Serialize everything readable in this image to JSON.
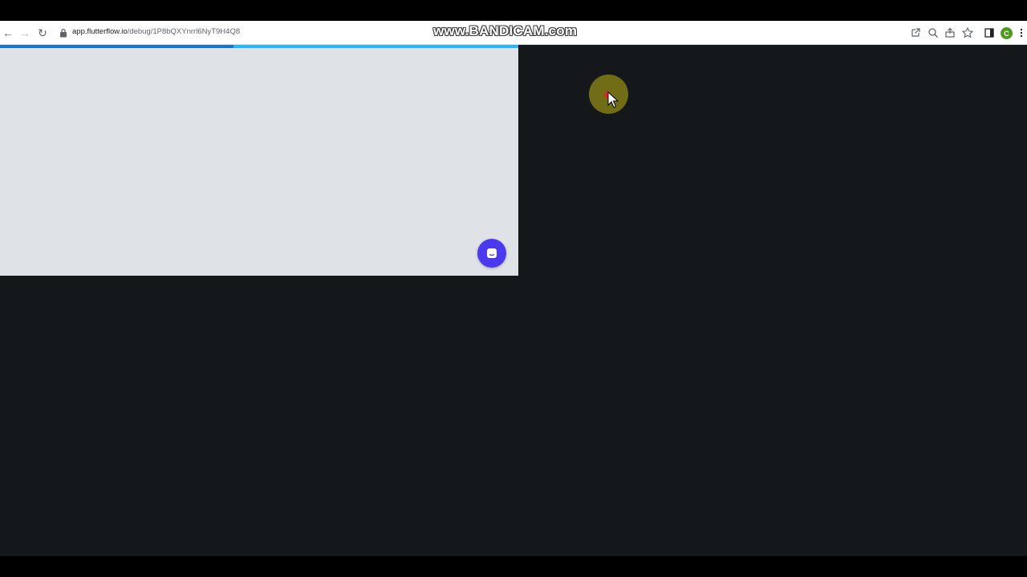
{
  "browser": {
    "url_host": "app.flutterflow.io",
    "url_path": "/debug/1P8bQXYnrrl6NyT9H4Q8",
    "icons": [
      "back-icon",
      "forward-icon",
      "reload-icon",
      "lock-icon",
      "open-external-icon",
      "zoom-icon",
      "share-icon",
      "star-icon",
      "sidebar-icon",
      "kebab-menu-icon"
    ],
    "profile_initial": "C",
    "profile_color": "#4e9a1f"
  },
  "watermark": {
    "text": "www.BANDICAM.com"
  },
  "page": {
    "background": "#14181b",
    "app_background": "#dfe3e7",
    "loading_progress": 0.45,
    "progress_track_color": "#29b6f6",
    "progress_fill_color": "#1a73c8",
    "chat_button_color": "#4b39ef"
  },
  "cursor": {
    "highlight_color": "#beb414",
    "click_color": "#d62d20"
  }
}
